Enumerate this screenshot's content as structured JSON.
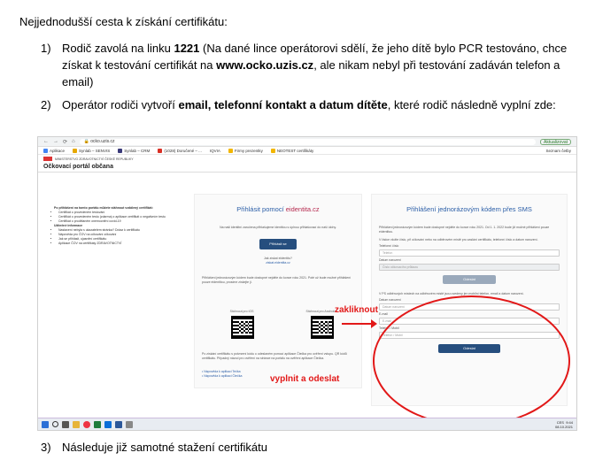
{
  "intro": "Nejjednodušší cesta k získání certifikátu:",
  "items": [
    {
      "num": "1)",
      "parts": [
        "Rodič zavolá na linku ",
        "1221",
        " (Na dané lince operátorovi sdělí, že jeho dítě bylo PCR testováno, chce získat k testování certifikát na ",
        "www.ocko.uzis.cz",
        ", ale nikam nebyl při testování zadáván telefon a email)"
      ]
    },
    {
      "num": "2)",
      "parts": [
        "Operátor rodiči vytvoří ",
        "email, telefonní kontakt a datum dítěte",
        ", které rodič následně vyplní zde:"
      ]
    },
    {
      "num": "3)",
      "text": "Následuje již samotné stažení certifikátu"
    }
  ],
  "screenshot": {
    "address": "ocko.uzis.cz",
    "update_label": "Aktualizovat",
    "bookmarks": [
      "Aplikace",
      "Synlab – SENVIS",
      "Synlab – CRM",
      "(1028) Doručené – ...",
      "IQVIA",
      "Firmy prezentky",
      "NEOTEST certifikáty"
    ],
    "reading_list": "Seznam četby",
    "logo_text": "MINISTERSTVO ZDRAVOTNICTVÍ ČESKÉ REPUBLIKY",
    "portal_title": "Očkovací portál občana",
    "left_heading": "Po přihlášení na tomto portálu můžete stáhnout vzdálený certifikát:",
    "left_items": [
      "Certifikát o provedeném testování",
      "Certifikát o provedeném testu (zdarma) z aplikace certifikát o negativním testu",
      "Certifikát o prodělaném onemocnění covid-19"
    ],
    "left_heading2": "Užitečné informace",
    "left_items2": [
      "Nastavení nebyla s ukazatelem stránka? Dotaz k certifikátu",
      "Nápověda pro ČOV na očkování očkování",
      "Jak se přihlásit, ujasnění certifikátu",
      "Aplikace ČOV na certifikáty ZDRAVOTNICTVÍ"
    ],
    "mid_title_a": "Přihlásit pomocí ",
    "mid_title_b": "eidentita.cz",
    "mid_text": "Na naši identitní zaručena přihlašujeme identitou s úplnou přihlašovací do naší úlohy.",
    "mid_btn": "Přihlásit se",
    "mid_q": "Jak získat eIdentitu?",
    "mid_link": "ziskat.eidentita.cz",
    "mid_text2": "Přihlášení jednorázovým kódem bude dostupné nejdéle do konce roku 2021. Poté už bude možné přihlášení pouze eidentitou, prosíme získejte ji.",
    "qr1_label": "Stáhnout pro iOS",
    "qr2_label": "Stáhnout pro Android",
    "mid_text3": "Po získání certifikátu s potvrzení kódu o odeslaném pomocí aplikace Čtečka pro ověření vstupu. QR kódů certifikátu. Případný návod pro ověření na stránce na portálu na ověření aplikace Čtečka.",
    "mid_links": [
      "Nápověda k aplikaci Tečka",
      "Nápověda k aplikaci Čtečka"
    ],
    "right_title": "Přihlášení jednorázovým kódem přes SMS",
    "right_text": "Přihlášení jednorázovým kódem bude dostupné nejdéle do konce roku 2021. Od 1. 1. 2022 bude již možné přihlášení pouze eidentitou.",
    "right_text2": "V řádce vložte číslo, při očkování nebo na odběrovém místě pro zaslání certifikátu, telefonní číslo a datum narození.",
    "field_labels": [
      "Telefonní číslo",
      "Datum narození"
    ],
    "field_placeholders": [
      "Telefon",
      "Číslo očkovacího průkazu"
    ],
    "right_btn": "Odeslat",
    "right_text3": "V PS odběrových místech na odběrovém místě jsou uvedeny jen mobilní telefon, email a datum narození.",
    "field2_labels": [
      "Datum narození",
      "E-mail",
      "Telefon / Mobil"
    ],
    "field2_placeholders": [
      "Datum narození",
      "E-mail",
      "Telefon / Mobil"
    ],
    "right_btn2": "Odeslat",
    "annot_click": "zakliknout",
    "annot_fill": "vyplnit a odeslat",
    "time": "9:44",
    "date": "08.10.2021",
    "lang": "CES"
  }
}
